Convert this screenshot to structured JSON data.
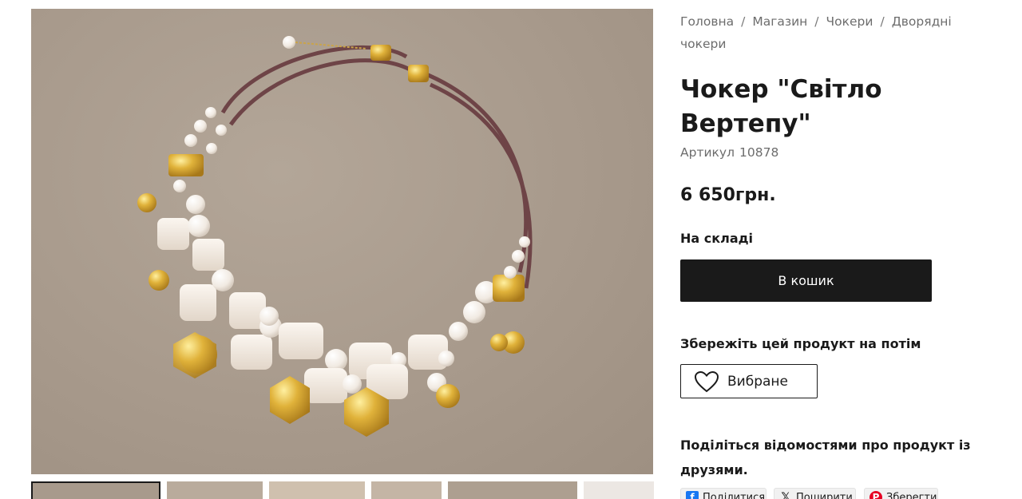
{
  "breadcrumb": {
    "home": "Головна",
    "shop": "Магазин",
    "category": "Чокери",
    "subcategory": "Дворядні чокери",
    "separator": "/"
  },
  "product": {
    "title": "Чокер \"Світло Вертепу\"",
    "sku_label": "Артикул",
    "sku": "10878",
    "price": "6 650грн.",
    "stock": "На складі",
    "cart_label": "В кошик"
  },
  "wishlist": {
    "heading": "Збережіть цей продукт на потім",
    "button_label": "Вибране",
    "icon": "heart-icon"
  },
  "share": {
    "heading": "Поділіться відомостями про продукт із друзями.",
    "buttons": [
      {
        "label": "Поділитися",
        "icon": "facebook-icon"
      },
      {
        "label": "Поширити",
        "icon": "x-icon"
      },
      {
        "label": "Зберегти",
        "icon": "pinterest-icon"
      }
    ]
  },
  "gallery": {
    "thumbnail_count": 6
  },
  "colors": {
    "primary_button": "#1a1a1a",
    "text_muted": "#6d6d6d",
    "image_background": "#a89a8c",
    "gold": "#d4a52a",
    "bead": "#f6f0ea",
    "cord": "#6e4447"
  }
}
